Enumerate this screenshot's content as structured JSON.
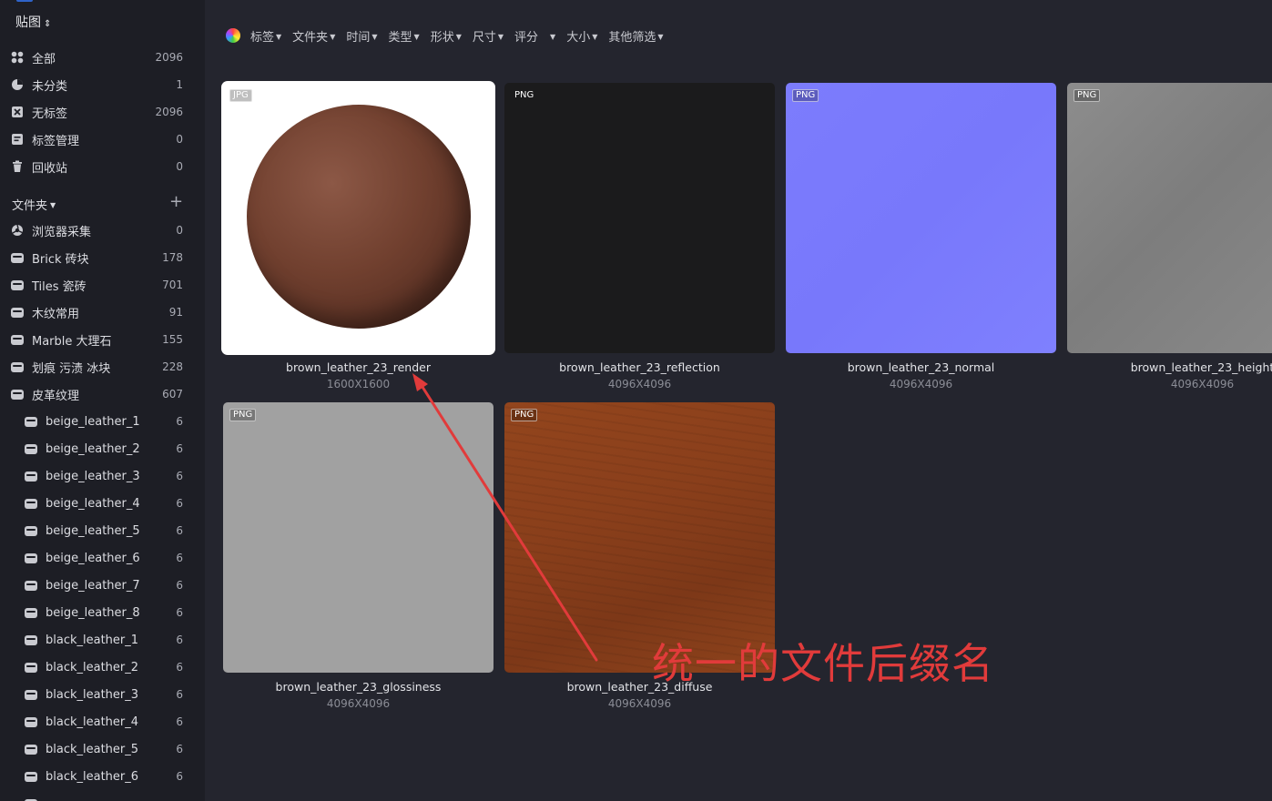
{
  "sidebar": {
    "library_title": "贴图",
    "nav": [
      {
        "label": "全部",
        "count": "2096",
        "icon": "all-icon"
      },
      {
        "label": "未分类",
        "count": "1",
        "icon": "uncategorized-icon"
      },
      {
        "label": "无标签",
        "count": "2096",
        "icon": "untagged-icon"
      },
      {
        "label": "标签管理",
        "count": "0",
        "icon": "tag-manage-icon"
      },
      {
        "label": "回收站",
        "count": "0",
        "icon": "trash-icon"
      }
    ],
    "folders_title": "文件夹",
    "folders": [
      {
        "label": "浏览器采集",
        "count": "0",
        "icon": "browser-collect-icon"
      },
      {
        "label": "Brick 砖块",
        "count": "178",
        "icon": "folder-icon"
      },
      {
        "label": "Tiles 瓷砖",
        "count": "701",
        "icon": "folder-icon"
      },
      {
        "label": "木纹常用",
        "count": "91",
        "icon": "folder-icon"
      },
      {
        "label": "Marble 大理石",
        "count": "155",
        "icon": "folder-icon"
      },
      {
        "label": "划痕 污渍 冰块",
        "count": "228",
        "icon": "folder-icon"
      },
      {
        "label": "皮革纹理",
        "count": "607",
        "icon": "folder-icon"
      }
    ],
    "subfolders": [
      {
        "label": "beige_leather_1",
        "count": "6"
      },
      {
        "label": "beige_leather_2",
        "count": "6"
      },
      {
        "label": "beige_leather_3",
        "count": "6"
      },
      {
        "label": "beige_leather_4",
        "count": "6"
      },
      {
        "label": "beige_leather_5",
        "count": "6"
      },
      {
        "label": "beige_leather_6",
        "count": "6"
      },
      {
        "label": "beige_leather_7",
        "count": "6"
      },
      {
        "label": "beige_leather_8",
        "count": "6"
      },
      {
        "label": "black_leather_1",
        "count": "6"
      },
      {
        "label": "black_leather_2",
        "count": "6"
      },
      {
        "label": "black_leather_3",
        "count": "6"
      },
      {
        "label": "black_leather_4",
        "count": "6"
      },
      {
        "label": "black_leather_5",
        "count": "6"
      },
      {
        "label": "black_leather_6",
        "count": "6"
      }
    ]
  },
  "filters": [
    "标签",
    "文件夹",
    "时间",
    "类型",
    "形状",
    "尺寸",
    "评分",
    "大小",
    "其他筛选"
  ],
  "items": [
    {
      "badge": "JPG",
      "name": "brown_leather_23_render",
      "dims": "1600X1600"
    },
    {
      "badge": "PNG",
      "name": "brown_leather_23_reflection",
      "dims": "4096X4096"
    },
    {
      "badge": "PNG",
      "name": "brown_leather_23_normal",
      "dims": "4096X4096"
    },
    {
      "badge": "PNG",
      "name": "brown_leather_23_height",
      "dims": "4096X4096"
    },
    {
      "badge": "PNG",
      "name": "brown_leather_23_glossiness",
      "dims": "4096X4096"
    },
    {
      "badge": "PNG",
      "name": "brown_leather_23_diffuse",
      "dims": "4096X4096"
    }
  ],
  "annotation": "统一的文件后缀名",
  "colors": {
    "annotation": "#e13b3b",
    "sidebar_bg": "#1d1e25",
    "main_bg": "#24252e"
  }
}
